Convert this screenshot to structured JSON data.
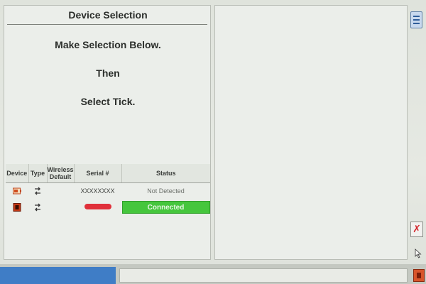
{
  "left_panel": {
    "title": "Device Selection",
    "instructions": [
      "Make Selection Below.",
      "Then",
      "Select Tick."
    ]
  },
  "table": {
    "headers": {
      "device": "Device",
      "type": "Type",
      "wireless": "Wireless Default",
      "serial": "Serial #",
      "status": "Status"
    },
    "rows": [
      {
        "device_icon": "adapter-icon",
        "type_icon": "usb-transfer-icon",
        "wireless": "",
        "serial": "XXXXXXXX",
        "status": "Not Detected",
        "status_color": ""
      },
      {
        "device_icon": "vci-device-icon",
        "type_icon": "usb-transfer-icon",
        "wireless": "",
        "serial": "",
        "serial_redacted": true,
        "status": "Connected",
        "status_color": "#45c63d"
      }
    ]
  },
  "controls": {
    "menu_icon": "menu-icon",
    "close_icon": "close-icon",
    "close_glyph": "✗",
    "tick_icon": "tick-icon"
  },
  "colors": {
    "connected": "#45c63d",
    "taskbar_blue": "#3f7dc6",
    "close_red": "#d3262c"
  }
}
